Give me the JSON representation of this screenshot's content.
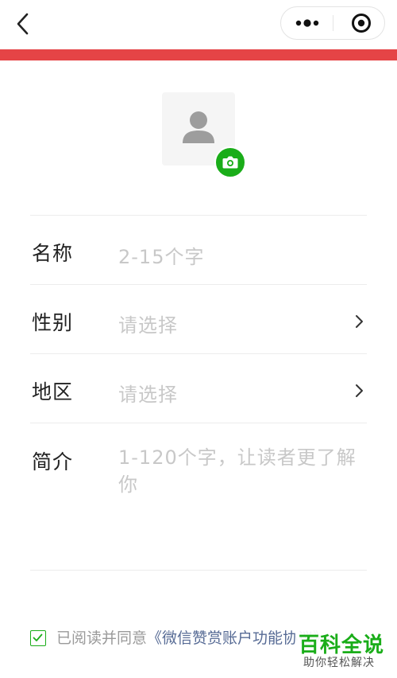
{
  "nav": {
    "back_icon": "chevron-left-icon",
    "more_icon": "more-dots-icon",
    "close_icon": "target-circle-icon"
  },
  "colors": {
    "accent_bar": "#e54446",
    "brand_green": "#1aad19",
    "link_blue": "#576b95",
    "placeholder_gray": "#c8c8c8"
  },
  "avatar": {
    "icon": "user-silhouette-icon",
    "badge_icon": "camera-icon"
  },
  "form": {
    "name_label": "名称",
    "name_placeholder": "2-15个字",
    "gender_label": "性别",
    "gender_value": "请选择",
    "region_label": "地区",
    "region_value": "请选择",
    "intro_label": "简介",
    "intro_placeholder": "1-120个字，让读者更了解你"
  },
  "agreement": {
    "checked": true,
    "prefix": "已阅读并同意",
    "link_text": "《微信赞赏账户功能协议》"
  },
  "watermark": {
    "title": "百科全说",
    "subtitle": "助你轻松解决"
  }
}
